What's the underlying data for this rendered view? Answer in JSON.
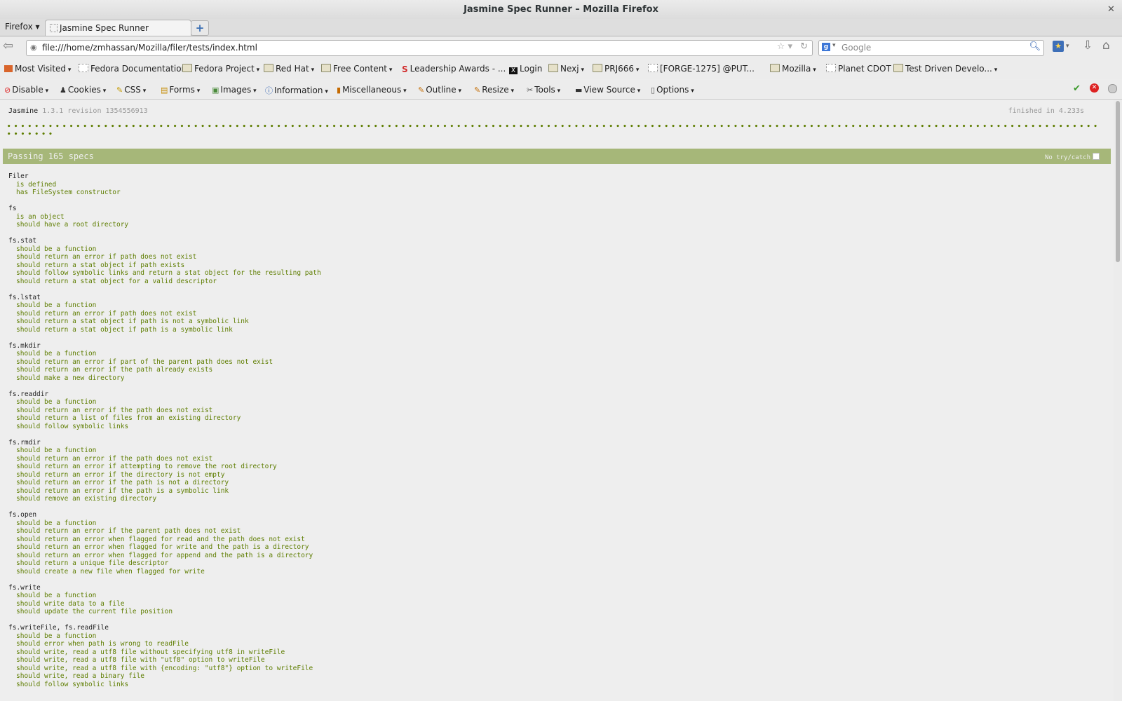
{
  "window": {
    "title": "Jasmine Spec Runner – Mozilla Firefox",
    "firefox_menu": "Firefox",
    "tab_title": "Jasmine Spec Runner",
    "new_tab": "+"
  },
  "navbar": {
    "url": "file:///home/zmhassan/Mozilla/filer/tests/index.html",
    "search_placeholder": "Google"
  },
  "bookmarks": [
    {
      "label": "Most Visited",
      "icon": "most-visited",
      "dropdown": true
    },
    {
      "label": "Fedora Documentation",
      "icon": "page",
      "dropdown": false
    },
    {
      "label": "Fedora Project",
      "icon": "folder",
      "dropdown": true
    },
    {
      "label": "Red Hat",
      "icon": "folder",
      "dropdown": true
    },
    {
      "label": "Free Content",
      "icon": "folder",
      "dropdown": true
    },
    {
      "label": "Leadership Awards - ...",
      "icon": "s-logo",
      "dropdown": false
    },
    {
      "label": "Login",
      "icon": "x-logo",
      "dropdown": false
    },
    {
      "label": "Nexj",
      "icon": "folder",
      "dropdown": true
    },
    {
      "label": "PRJ666",
      "icon": "folder",
      "dropdown": true
    },
    {
      "label": "[FORGE-1275] @PUT...",
      "icon": "page",
      "dropdown": false
    },
    {
      "label": "Mozilla",
      "icon": "folder",
      "dropdown": true
    },
    {
      "label": "Planet CDOT",
      "icon": "page",
      "dropdown": false
    },
    {
      "label": "Test Driven Develo...",
      "icon": "folder",
      "dropdown": true
    }
  ],
  "webdev_toolbar": [
    {
      "label": "Disable",
      "icon": "disable-icon"
    },
    {
      "label": "Cookies",
      "icon": "cookies-icon"
    },
    {
      "label": "CSS",
      "icon": "css-icon"
    },
    {
      "label": "Forms",
      "icon": "forms-icon"
    },
    {
      "label": "Images",
      "icon": "images-icon"
    },
    {
      "label": "Information",
      "icon": "information-icon"
    },
    {
      "label": "Miscellaneous",
      "icon": "miscellaneous-icon"
    },
    {
      "label": "Outline",
      "icon": "outline-icon"
    },
    {
      "label": "Resize",
      "icon": "resize-icon"
    },
    {
      "label": "Tools",
      "icon": "tools-icon"
    },
    {
      "label": "View Source",
      "icon": "view-source-icon"
    },
    {
      "label": "Options",
      "icon": "options-icon"
    }
  ],
  "jasmine": {
    "name": "Jasmine",
    "version": "1.3.1 revision 1354556913",
    "duration": "finished in 4.233s",
    "spec_count": 165,
    "passing_text": "Passing 165 specs",
    "trycatch_label": "No try/catch"
  },
  "suites": [
    {
      "name": "Filer",
      "specs": [
        "is defined",
        "has FileSystem constructor"
      ]
    },
    {
      "name": "fs",
      "specs": [
        "is an object",
        "should have a root directory"
      ]
    },
    {
      "name": "fs.stat",
      "specs": [
        "should be a function",
        "should return an error if path does not exist",
        "should return a stat object if path exists",
        "should follow symbolic links and return a stat object for the resulting path",
        "should return a stat object for a valid descriptor"
      ]
    },
    {
      "name": "fs.lstat",
      "specs": [
        "should be a function",
        "should return an error if path does not exist",
        "should return a stat object if path is not a symbolic link",
        "should return a stat object if path is a symbolic link"
      ]
    },
    {
      "name": "fs.mkdir",
      "specs": [
        "should be a function",
        "should return an error if part of the parent path does not exist",
        "should return an error if the path already exists",
        "should make a new directory"
      ]
    },
    {
      "name": "fs.readdir",
      "specs": [
        "should be a function",
        "should return an error if the path does not exist",
        "should return a list of files from an existing directory",
        "should follow symbolic links"
      ]
    },
    {
      "name": "fs.rmdir",
      "specs": [
        "should be a function",
        "should return an error if the path does not exist",
        "should return an error if attempting to remove the root directory",
        "should return an error if the directory is not empty",
        "should return an error if the path is not a directory",
        "should return an error if the path is a symbolic link",
        "should remove an existing directory"
      ]
    },
    {
      "name": "fs.open",
      "specs": [
        "should be a function",
        "should return an error if the parent path does not exist",
        "should return an error when flagged for read and the path does not exist",
        "should return an error when flagged for write and the path is a directory",
        "should return an error when flagged for append and the path is a directory",
        "should return a unique file descriptor",
        "should create a new file when flagged for write"
      ]
    },
    {
      "name": "fs.write",
      "specs": [
        "should be a function",
        "should write data to a file",
        "should update the current file position"
      ]
    },
    {
      "name": "fs.writeFile, fs.readFile",
      "specs": [
        "should be a function",
        "should error when path is wrong to readFile",
        "should write, read a utf8 file without specifying utf8 in writeFile",
        "should write, read a utf8 file with \"utf8\" option to writeFile",
        "should write, read a utf8 file with {encoding: \"utf8\"} option to writeFile",
        "should write, read a binary file",
        "should follow symbolic links"
      ]
    }
  ],
  "colors": {
    "passing_bar": "#a6b779",
    "spec_green": "#5e7d00",
    "background": "#eeeeee"
  }
}
